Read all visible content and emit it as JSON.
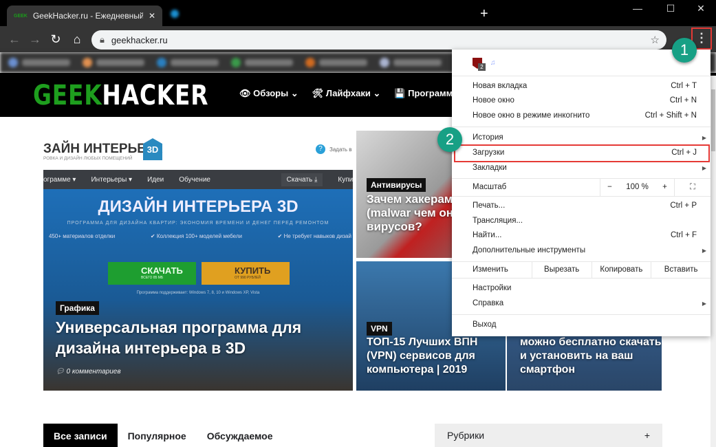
{
  "browser": {
    "tab_title": "GeekHacker.ru - Ежедневный жу",
    "tab_favicon": "GEEK",
    "url": "geekhacker.ru",
    "new_tab": "+",
    "window": {
      "minimize": "—",
      "maximize": "☐",
      "close": "✕"
    }
  },
  "site": {
    "logo_geek": "GEEK",
    "logo_hacker": "HACKER",
    "nav": [
      "👁 Обзоры ⌄",
      "🛠 Лайфхаки ⌄",
      "💾 Программы"
    ],
    "main_card": {
      "brand": "ЗАЙН ИНТЕРЬЕРА",
      "brand_badge": "3D",
      "brand_sub": "РОВКА И ДИЗАЙН ЛЮБЫХ ПОМЕЩЕНИЙ",
      "ask": "Задать в",
      "nav": [
        "ограмме ▾",
        "Интерьеры ▾",
        "Идеи",
        "Обучение"
      ],
      "download_link": "Скачать ⤓",
      "buy_link": "Купить",
      "hero_title": "ДИЗАЙН ИНТЕРЬЕРА 3D",
      "hero_sub": "ПРОГРАММА ДЛЯ ДИЗАЙНА КВАРТИР: ЭКОНОМИЯ ВРЕМЕНИ И ДЕНЕГ ПЕРЕД РЕМОНТОМ",
      "features": [
        "450+ материалов отделки",
        "✔ Коллекция 100+ моделей мебели",
        "✔ Не требует навыков дизай"
      ],
      "btn_download": "СКАЧАТЬ",
      "btn_download_sub": "ВСЕГО 85 МБ",
      "btn_buy": "КУПИТЬ",
      "btn_buy_sub": "ОТ 990 РУБЛЕЙ",
      "support": "Программа поддерживает: Windows 7, 8, 10 и Windows XP, Vista",
      "category": "Графика",
      "title": "Универсальная программа для дизайна интерьера в 3D",
      "comments": "0 комментариев"
    },
    "card_av": {
      "category": "Антивирусы",
      "title": "Зачем хакерам взлома (malwar чем оно отлича вирусов?"
    },
    "card_vpn": {
      "category": "VPN",
      "title": "ТОП-15 Лучших ВПН (VPN) сервисов для компьютера | 2019"
    },
    "card_android": {
      "title": "можно бесплатно скачать и установить на ваш смартфон"
    },
    "post_tabs": [
      "Все записи",
      "Популярное",
      "Обсуждаемое"
    ],
    "rubrics": {
      "label": "Рубрики",
      "toggle": "+"
    }
  },
  "menu": {
    "ext_badge": "2",
    "items": [
      {
        "label": "Новая вкладка",
        "shortcut": "Ctrl + T"
      },
      {
        "label": "Новое окно",
        "shortcut": "Ctrl + N"
      },
      {
        "label": "Новое окно в режиме инкогнито",
        "shortcut": "Ctrl + Shift + N"
      },
      {
        "label": "История",
        "shortcut": ""
      },
      {
        "label": "Загрузки",
        "shortcut": "Ctrl + J"
      },
      {
        "label": "Закладки",
        "shortcut": ""
      },
      {
        "label": "Печать...",
        "shortcut": "Ctrl + P"
      },
      {
        "label": "Трансляция...",
        "shortcut": ""
      },
      {
        "label": "Найти...",
        "shortcut": "Ctrl + F"
      },
      {
        "label": "Дополнительные инструменты",
        "shortcut": ""
      },
      {
        "label": "Настройки",
        "shortcut": ""
      },
      {
        "label": "Справка",
        "shortcut": ""
      },
      {
        "label": "Выход",
        "shortcut": ""
      }
    ],
    "zoom": {
      "label": "Масштаб",
      "minus": "−",
      "value": "100 %",
      "plus": "+"
    },
    "edit": {
      "label": "Изменить",
      "cut": "Вырезать",
      "copy": "Копировать",
      "paste": "Вставить"
    }
  },
  "annotations": {
    "step1": "1",
    "step2": "2"
  },
  "colors": {
    "highlight": "#e53935",
    "badge": "#17a085"
  }
}
